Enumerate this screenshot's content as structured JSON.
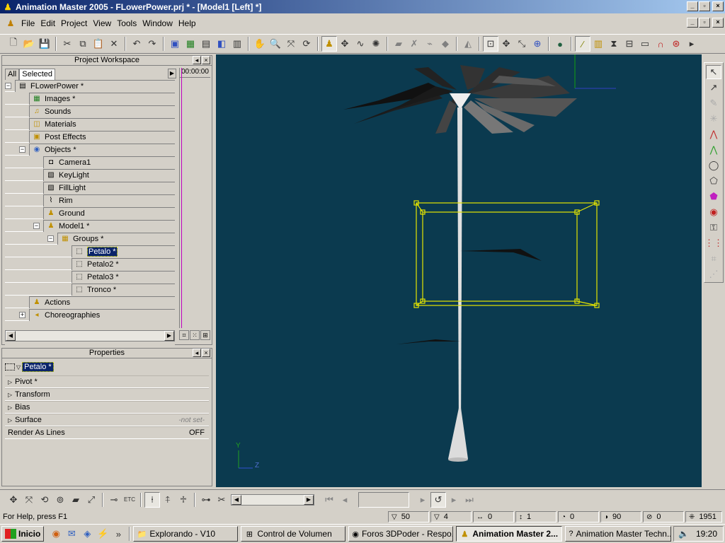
{
  "window": {
    "title": "Animation Master 2005 - FLowerPower.prj * - [Model1 [Left] *]",
    "buttons": [
      "_",
      "□",
      "×"
    ]
  },
  "menu": {
    "items": [
      "File",
      "Edit",
      "Project",
      "View",
      "Tools",
      "Window",
      "Help"
    ]
  },
  "toolbar": {
    "icons": [
      "new-icon",
      "open-icon",
      "save-icon",
      "cut-icon",
      "copy-icon",
      "paste-icon",
      "delete-icon",
      "undo-icon",
      "redo-icon",
      "render-icon",
      "render-settings-icon",
      "render-lock-icon",
      "render-to-file-icon",
      "film-icon",
      "hand-icon",
      "zoom-icon",
      "zoom-fit-icon",
      "turn-icon",
      "mode-select-icon",
      "bones-icon",
      "muscle-icon",
      "skin-icon",
      "script-icon",
      "action-icon",
      "pose-icon",
      "morph-icon",
      "rotoscope-icon",
      "grid-icon",
      "move-icon",
      "scale-icon",
      "rotate-icon",
      "globe-icon",
      "world-icon",
      "bone-mode-icon",
      "calc-icon",
      "keyframe-icon",
      "measure-icon",
      "magnet-icon",
      "display-icon",
      "more-icon"
    ]
  },
  "workspace": {
    "title": "Project Workspace",
    "tabs": [
      "All",
      "Selected"
    ],
    "timecode": "00:00:00",
    "tree": [
      {
        "label": "FLowerPower *",
        "icon": "project-icon",
        "indent": 0,
        "expander": "−"
      },
      {
        "label": "Images *",
        "icon": "images-icon",
        "indent": 1
      },
      {
        "label": "Sounds",
        "icon": "sounds-icon",
        "indent": 1
      },
      {
        "label": "Materials",
        "icon": "materials-icon",
        "indent": 1
      },
      {
        "label": "Post Effects",
        "icon": "post-effects-icon",
        "indent": 1
      },
      {
        "label": "Objects *",
        "icon": "objects-icon",
        "indent": 1,
        "expander": "−"
      },
      {
        "label": "Camera1",
        "icon": "camera-icon",
        "indent": 2
      },
      {
        "label": "KeyLight",
        "icon": "light-icon",
        "indent": 2
      },
      {
        "label": "FillLight",
        "icon": "light-icon",
        "indent": 2
      },
      {
        "label": "Rim",
        "icon": "rim-light-icon",
        "indent": 2
      },
      {
        "label": "Ground",
        "icon": "ground-icon",
        "indent": 2
      },
      {
        "label": "Model1 *",
        "icon": "model-icon",
        "indent": 2,
        "expander": "−"
      },
      {
        "label": "Groups *",
        "icon": "groups-icon",
        "indent": 3,
        "expander": "−"
      },
      {
        "label": "Petalo *",
        "icon": "group-icon",
        "indent": 4,
        "selected": true
      },
      {
        "label": "Petalo2 *",
        "icon": "group-icon",
        "indent": 4
      },
      {
        "label": "Petalo3 *",
        "icon": "group-icon",
        "indent": 4
      },
      {
        "label": "Tronco *",
        "icon": "group-icon",
        "indent": 4
      },
      {
        "label": "Actions",
        "icon": "actions-icon",
        "indent": 1
      },
      {
        "label": "Choreographies",
        "icon": "choreography-icon",
        "indent": 1,
        "expander": "+"
      }
    ]
  },
  "properties": {
    "title": "Properties",
    "selected": "Petalo *",
    "rows": [
      {
        "label": "Pivot *",
        "value": "",
        "expandable": true
      },
      {
        "label": "Transform",
        "value": "",
        "expandable": true
      },
      {
        "label": "Bias",
        "value": "",
        "expandable": true
      },
      {
        "label": "Surface",
        "value": "-not set-",
        "expandable": true
      },
      {
        "label": "Render As Lines",
        "value": "OFF",
        "expandable": false
      }
    ]
  },
  "viewport": {
    "view_name": "Left",
    "axis_y": "Y",
    "axis_z": "Z",
    "background": "#0b3a4f"
  },
  "right_toolbar": {
    "icons": [
      "arrow-select-icon",
      "add-point-icon",
      "lathe-icon",
      "extrude-icon",
      "peak-icon",
      "smooth-icon",
      "lasso-icon",
      "group-icon",
      "material-icon",
      "decal-icon",
      "lock-icon",
      "bias-icon",
      "hook-icon",
      "normals-icon"
    ]
  },
  "status": {
    "help": "For Help, press F1",
    "cells": [
      {
        "icon": "cp-icon",
        "value": "50"
      },
      {
        "icon": "patch-icon",
        "value": "4"
      },
      {
        "icon": "width-icon",
        "value": "0"
      },
      {
        "icon": "height-icon",
        "value": "1"
      },
      {
        "icon": "angle-icon",
        "value": "0"
      },
      {
        "icon": "rotate-icon",
        "value": "90"
      },
      {
        "icon": "roll-icon",
        "value": "0"
      },
      {
        "icon": "count-icon",
        "value": "1951"
      }
    ]
  },
  "taskbar": {
    "start": "Inicio",
    "tasks": [
      {
        "label": "Explorando - V10",
        "active": false
      },
      {
        "label": "Control de Volumen",
        "active": false
      },
      {
        "label": "Foros 3DPoder - Respo...",
        "active": false
      },
      {
        "label": "Animation Master 2...",
        "active": true
      },
      {
        "label": "Animation Master Techn...",
        "active": false
      }
    ],
    "time": "19:20"
  },
  "colors": {
    "titlebar_start": "#0a246a",
    "titlebar_end": "#a6caf0",
    "viewport_bg": "#0b3a4f",
    "selection_yellow": "#e6e600",
    "timeline_marker": "#c000c0"
  }
}
